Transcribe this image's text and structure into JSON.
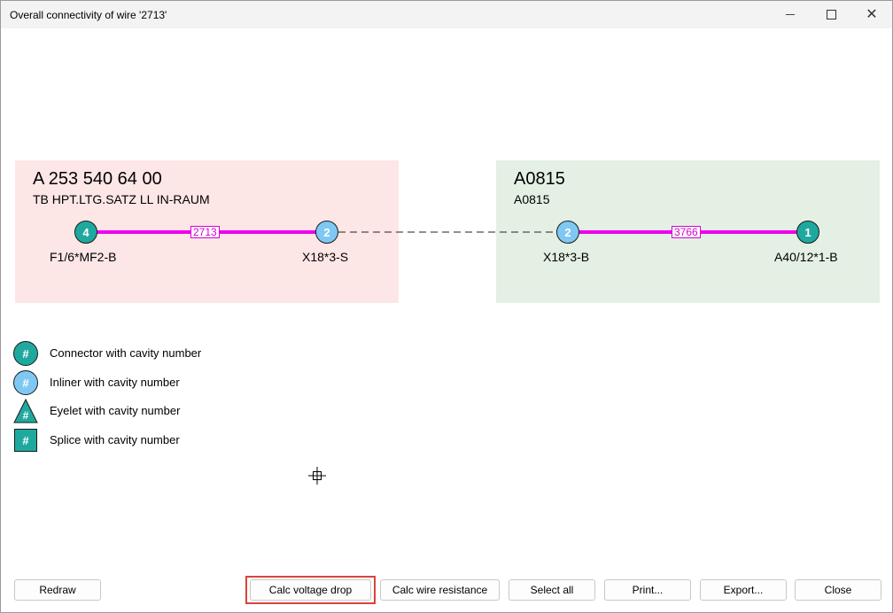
{
  "window": {
    "title": "Overall connectivity of wire '2713'",
    "controls": [
      "minimize-icon",
      "maximize-icon",
      "close-icon"
    ]
  },
  "harnesses": [
    {
      "title": "A 253 540 64 00",
      "subtitle": "TB HPT.LTG.SATZ LL IN-RAUM",
      "color": "#fde6e6",
      "wire_label": "2713",
      "left_node": {
        "cavity": "4",
        "type": "connector",
        "label": "F1/6*MF2-B"
      },
      "right_node": {
        "cavity": "2",
        "type": "inliner",
        "label": "X18*3-S"
      }
    },
    {
      "title": "A0815",
      "subtitle": "A0815",
      "color": "#e5f0e4",
      "wire_label": "3766",
      "left_node": {
        "cavity": "2",
        "type": "inliner",
        "label": "X18*3-B"
      },
      "right_node": {
        "cavity": "1",
        "type": "connector",
        "label": "A40/12*1-B"
      }
    }
  ],
  "colors": {
    "wire": "#ee00ee",
    "connector": "#1fa99e",
    "inliner": "#7fc8f4",
    "highlight": "#d9443c"
  },
  "legend": {
    "symbol": "#",
    "items": [
      {
        "icon": "connector-icon",
        "label": "Connector with cavity number"
      },
      {
        "icon": "inliner-icon",
        "label": "Inliner with cavity number"
      },
      {
        "icon": "eyelet-icon",
        "label": "Eyelet with cavity number"
      },
      {
        "icon": "splice-icon",
        "label": "Splice with cavity number"
      }
    ]
  },
  "buttons": {
    "redraw": "Redraw",
    "calc_voltage_drop": "Calc voltage drop",
    "calc_wire_resistance": "Calc wire resistance",
    "select_all": "Select all",
    "print": "Print...",
    "export": "Export...",
    "close": "Close"
  }
}
